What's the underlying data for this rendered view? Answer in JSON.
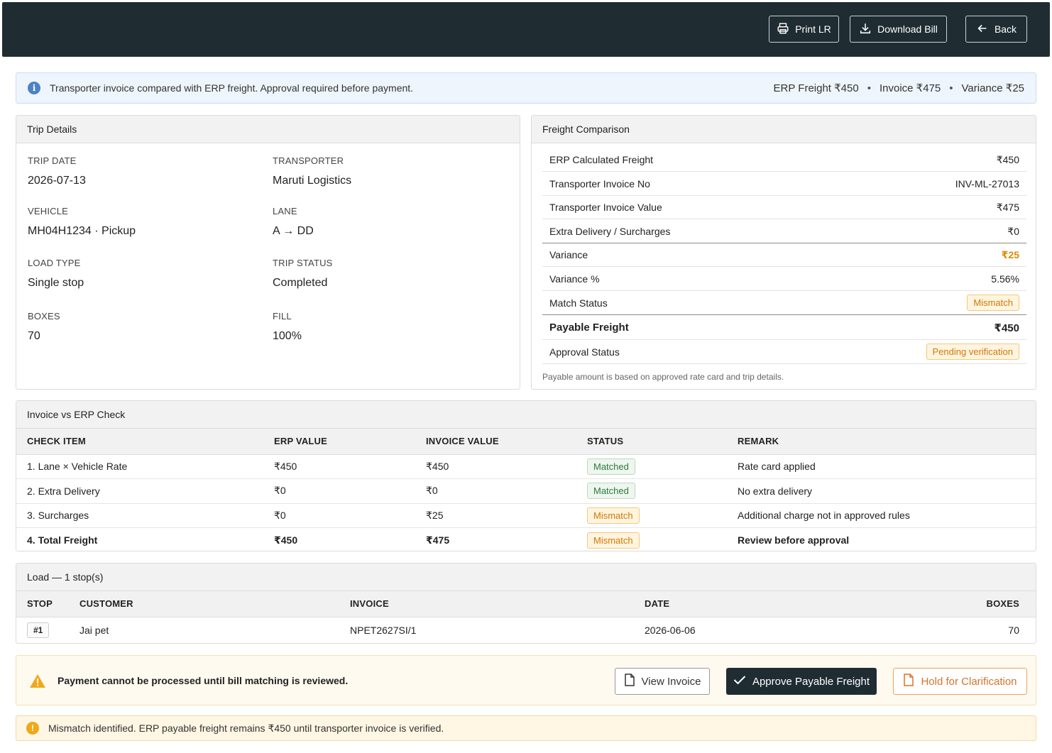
{
  "header": {
    "print_label": "Print LR",
    "download_label": "Download Bill",
    "back_label": "Back"
  },
  "info": {
    "message": "Transporter invoice compared with ERP freight. Approval required before payment.",
    "erp_freight": "ERP Freight ₹450",
    "invoice": "Invoice ₹475",
    "variance": "Variance ₹25"
  },
  "trip": {
    "title": "Trip Details",
    "fields": [
      {
        "label": "TRIP DATE",
        "value": "2026-07-13"
      },
      {
        "label": "TRANSPORTER",
        "value": "Maruti Logistics"
      },
      {
        "label": "VEHICLE",
        "value": "MH04H1234 · Pickup"
      },
      {
        "label": "LANE",
        "value": "A → DD"
      },
      {
        "label": "LOAD TYPE",
        "value": "Single stop"
      },
      {
        "label": "TRIP STATUS",
        "value": "Completed"
      },
      {
        "label": "BOXES",
        "value": "70"
      },
      {
        "label": "FILL",
        "value": "100%"
      }
    ]
  },
  "freight": {
    "title": "Freight Comparison",
    "rows": [
      {
        "label": "ERP Calculated Freight",
        "value": "₹450"
      },
      {
        "label": "Transporter Invoice No",
        "value": "INV-ML-27013"
      },
      {
        "label": "Transporter Invoice Value",
        "value": "₹475"
      },
      {
        "label": "Extra Delivery / Surcharges",
        "value": "₹0"
      },
      {
        "label": "Variance",
        "value": "₹25"
      },
      {
        "label": "Variance %",
        "value": "5.56%"
      },
      {
        "label": "Match Status",
        "value": "Mismatch"
      },
      {
        "label": "Payable Freight",
        "value": "₹450"
      },
      {
        "label": "Approval Status",
        "value": "Pending verification"
      }
    ],
    "note": "Payable amount is based on approved rate card and trip details."
  },
  "check": {
    "title": "Invoice vs ERP Check",
    "headers": [
      "CHECK ITEM",
      "ERP VALUE",
      "INVOICE VALUE",
      "STATUS",
      "REMARK"
    ],
    "rows": [
      [
        "1. Lane × Vehicle Rate",
        "₹450",
        "₹450",
        "Matched",
        "Rate card applied"
      ],
      [
        "2. Extra Delivery",
        "₹0",
        "₹0",
        "Matched",
        "No extra delivery"
      ],
      [
        "3. Surcharges",
        "₹0",
        "₹25",
        "Mismatch",
        "Additional charge not in approved rules"
      ],
      [
        "4. Total Freight",
        "₹450",
        "₹475",
        "Mismatch",
        "Review before approval"
      ]
    ]
  },
  "load": {
    "title": "Load — 1 stop(s)",
    "headers": [
      "STOP",
      "CUSTOMER",
      "INVOICE",
      "DATE",
      "BOXES"
    ],
    "rows": [
      [
        "#1",
        "Jai pet",
        "NPET2627SI/1",
        "2026-06-06",
        "70"
      ]
    ]
  },
  "action": {
    "warning": "Payment cannot be processed until bill matching is reviewed.",
    "view_label": "View Invoice",
    "approve_label": "Approve Payable Freight",
    "hold_label": "Hold for Clarification"
  },
  "notice": {
    "message": "Mismatch identified. ERP payable freight remains ₹450 until transporter invoice is verified."
  },
  "colors": {
    "header_bg": "#1f2d33",
    "warning": "#e08a00",
    "success": "#2f7a3b",
    "info": "#4c82c6"
  }
}
